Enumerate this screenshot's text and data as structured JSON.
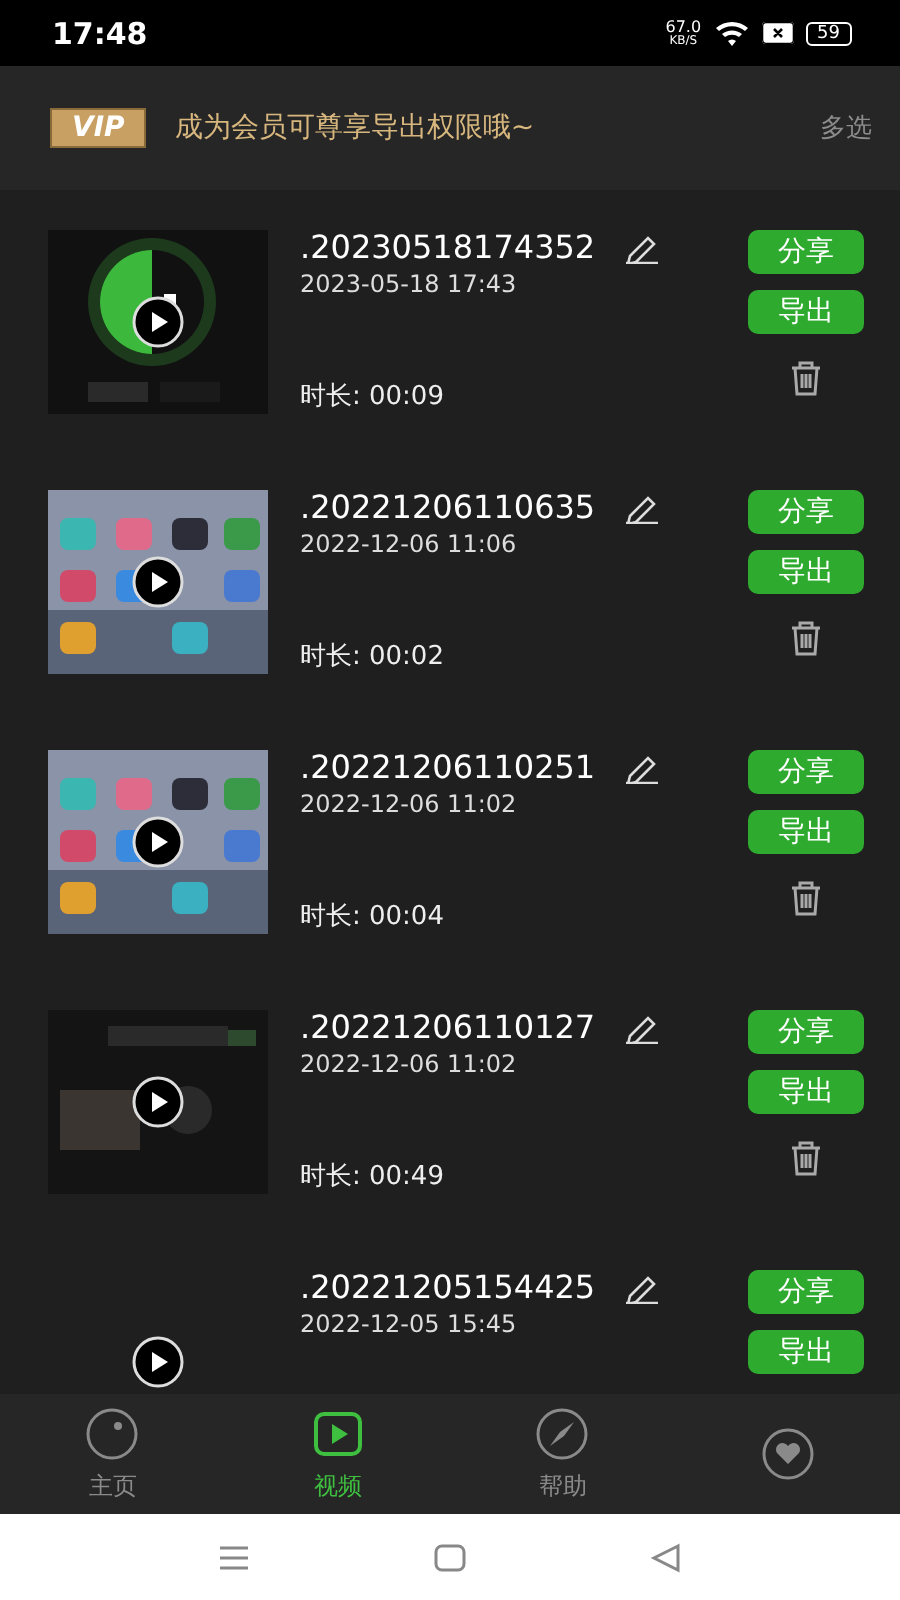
{
  "status_bar": {
    "time": "17:48",
    "net_speed": "67.0",
    "net_unit": "KB/S",
    "battery": "59"
  },
  "header": {
    "badge": "VIP",
    "promo": "成为会员可尊享导出权限哦~",
    "action": "多选"
  },
  "videos": [
    {
      "title": ".20230518174352",
      "date": "2023-05-18 17:43",
      "duration": "时长: 00:09",
      "share": "分享",
      "export": "导出"
    },
    {
      "title": ".20221206110635",
      "date": "2022-12-06 11:06",
      "duration": "时长: 00:02",
      "share": "分享",
      "export": "导出"
    },
    {
      "title": ".20221206110251",
      "date": "2022-12-06 11:02",
      "duration": "时长: 00:04",
      "share": "分享",
      "export": "导出"
    },
    {
      "title": ".20221206110127",
      "date": "2022-12-06 11:02",
      "duration": "时长: 00:49",
      "share": "分享",
      "export": "导出"
    },
    {
      "title": ".20221205154425",
      "date": "2022-12-05 15:45",
      "share": "分享",
      "export": "导出"
    }
  ],
  "tabs": [
    {
      "label": "主页",
      "selected": false
    },
    {
      "label": "视频",
      "selected": true
    },
    {
      "label": "帮助",
      "selected": false
    },
    {
      "selected": false
    }
  ]
}
